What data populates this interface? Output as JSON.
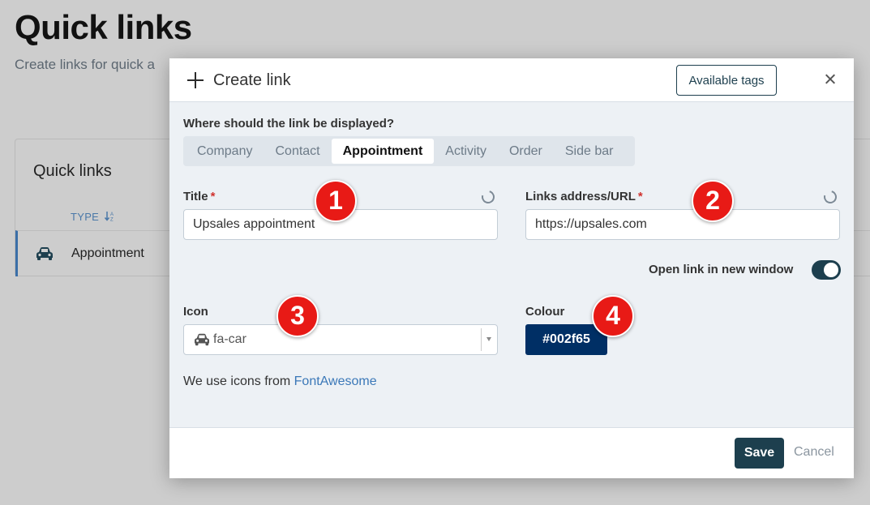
{
  "page": {
    "title": "Quick links",
    "description": "Create links for quick a"
  },
  "bg_card": {
    "title": "Quick links",
    "type_header": "TYPE",
    "sort_icon": "sort-alpha-icon",
    "row": {
      "icon": "car-icon",
      "label": "Appointment"
    }
  },
  "modal": {
    "title": "Create link",
    "available_tags": "Available tags",
    "display_question": "Where should the link be displayed?",
    "tabs": [
      {
        "label": "Company",
        "active": false
      },
      {
        "label": "Contact",
        "active": false
      },
      {
        "label": "Appointment",
        "active": true
      },
      {
        "label": "Activity",
        "active": false
      },
      {
        "label": "Order",
        "active": false
      },
      {
        "label": "Side bar",
        "active": false
      }
    ],
    "title_field": {
      "label": "Title",
      "required": "*",
      "value": "Upsales appointment"
    },
    "url_field": {
      "label": "Links address/URL",
      "required": "*",
      "value": "https://upsales.com"
    },
    "new_window": {
      "label": "Open link in new window",
      "on": true
    },
    "icon_field": {
      "label": "Icon",
      "value": "fa-car"
    },
    "colour_field": {
      "label": "Colour",
      "value": "#002f65"
    },
    "note_prefix": "We use icons from ",
    "note_link": "FontAwesome",
    "save": "Save",
    "cancel": "Cancel"
  },
  "badges": [
    "1",
    "2",
    "3",
    "4"
  ],
  "colors": {
    "primary": "#1d3f4e",
    "swatch": "#002f65",
    "badge": "#e81a16",
    "link": "#3b78b8"
  }
}
